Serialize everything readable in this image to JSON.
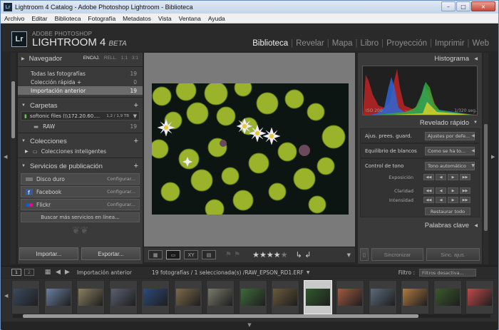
{
  "window": {
    "title": "Lightroom 4 Catalog - Adobe Photoshop Lightroom - Biblioteca",
    "app_icon": "Lr",
    "buttons": [
      "–",
      "□",
      "×"
    ]
  },
  "menu": [
    "Archivo",
    "Editar",
    "Biblioteca",
    "Fotografía",
    "Metadatos",
    "Vista",
    "Ventana",
    "Ayuda"
  ],
  "identity": {
    "logo": "Lr",
    "line1": "ADOBE PHOTOSHOP",
    "product": "LIGHTROOM 4",
    "edition": "BETA"
  },
  "modules": {
    "items": [
      "Biblioteca",
      "Revelar",
      "Mapa",
      "Libro",
      "Proyección",
      "Imprimir",
      "Web"
    ],
    "active": "Biblioteca"
  },
  "navigator": {
    "title": "Navegador",
    "options": [
      "ENCAJ.",
      "RELL.",
      "1:1",
      "3:1"
    ]
  },
  "catalog": {
    "rows": [
      {
        "label": "Todas las fotografías",
        "count": "19"
      },
      {
        "label": "Colección rápida +",
        "count": "0"
      },
      {
        "label": "Importación anterior",
        "count": "19"
      }
    ]
  },
  "folders": {
    "title": "Carpetas",
    "volume": {
      "label": "softonic files (\\\\172.20.60....",
      "size": "1,2 / 1,9 TB"
    },
    "folder": {
      "label": "RAW",
      "count": "19"
    }
  },
  "collections": {
    "title": "Colecciones",
    "smart": "Colecciones inteligentes"
  },
  "publish": {
    "title": "Servicios de publicación",
    "services": [
      {
        "label": "Disco duro",
        "config": "Configurar..."
      },
      {
        "label": "Facebook",
        "config": "Configurar..."
      },
      {
        "label": "Flickr",
        "config": "Configurar..."
      }
    ],
    "more": "Buscar más servicios en línea..."
  },
  "left_buttons": {
    "import": "Importar...",
    "export": "Exportar..."
  },
  "toolbar": {
    "views": [
      "grid",
      "loupe",
      "compare",
      "survey"
    ],
    "rating": 4,
    "max_rating": 5
  },
  "histogram": {
    "title": "Histograma",
    "iso": "ISO 200",
    "mid1": "--",
    "mid2": "--",
    "shutter": "1/320 seg."
  },
  "quick_develop": {
    "title": "Revelado rápido",
    "preset_label": "Ajus. prees. guard.",
    "preset_value": "Ajustes por defe...",
    "wb_label": "Equilibrio de blancos",
    "wb_value": "Como se ha to...",
    "tone_label": "Control de tono",
    "tone_value": "Tono automático",
    "sliders": [
      "Exposición",
      "Claridad",
      "Intensidad"
    ],
    "reset": "Restaurar todo"
  },
  "keywords": {
    "title": "Palabras clave"
  },
  "right_buttons": {
    "sync": "Sincronizar",
    "sync_settings": "Sinc. ajus."
  },
  "filmstrip": {
    "screens": [
      "1",
      "2"
    ],
    "source": "Importación anterior",
    "info": "19 fotografías / 1 seleccionada(s) /RAW_EPSON_RD1.ERF",
    "filter_label": "Filtro :",
    "filter_value": "Filtros desactiva...",
    "thumbnail_colors": [
      "#3a4a5e",
      "#6a7fa0",
      "#8a8060",
      "#5a6070",
      "#2c4a7c",
      "#7d6a4a",
      "#7a7a6a",
      "#3e6a3a",
      "#6a5a3a",
      "#2f5a2c",
      "#a05a40",
      "#5a6a7a",
      "#b07a40",
      "#3a5a2a",
      "#c04a4a"
    ],
    "selected_index": 9
  },
  "colors": {
    "accent": "#e0e0e0",
    "panel": "#3a3a3a",
    "window_frame": "#6a8fb8"
  }
}
